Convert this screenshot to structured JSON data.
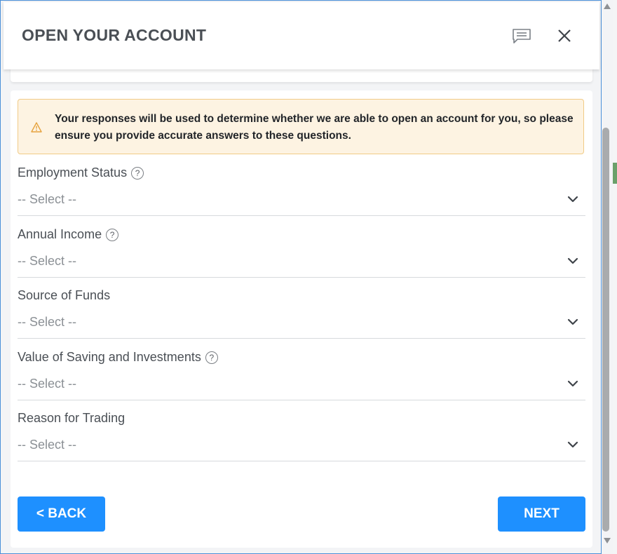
{
  "dialog": {
    "title": "OPEN YOUR ACCOUNT",
    "chat_icon": "chat-icon",
    "close_icon": "close-icon"
  },
  "alert": {
    "icon": "warning-icon",
    "text": "Your responses will be used to determine whether we are able to open an account for you, so please ensure you provide accurate answers to these questions.",
    "colors": {
      "background": "#fdf3e2",
      "border": "#f1cb86"
    }
  },
  "fields": [
    {
      "label": "Employment Status",
      "has_help": true,
      "value": "-- Select --"
    },
    {
      "label": "Annual Income",
      "has_help": true,
      "value": "-- Select --"
    },
    {
      "label": "Source of Funds",
      "has_help": false,
      "value": "-- Select --"
    },
    {
      "label": "Value of Saving and Investments",
      "has_help": true,
      "value": "-- Select --"
    },
    {
      "label": "Reason for Trading",
      "has_help": false,
      "value": "-- Select --"
    }
  ],
  "help_glyph": "?",
  "buttons": {
    "back": "< BACK",
    "next": "NEXT"
  },
  "colors": {
    "accent": "#1e90ff",
    "title_text": "#4a4f55",
    "window_border": "#4a90d9"
  }
}
